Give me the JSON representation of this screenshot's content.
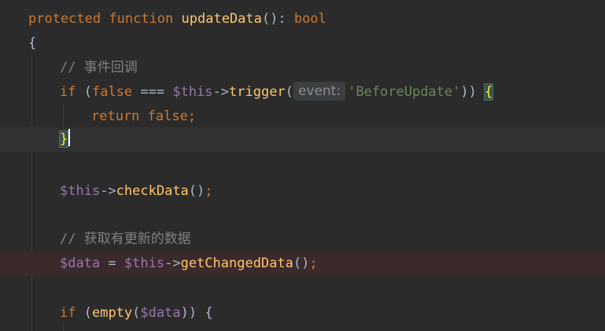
{
  "code": {
    "line1": {
      "kw_protected": "protected",
      "kw_function": "function",
      "fn_name": "updateData",
      "sig_rest": "(): ",
      "ret_type": "bool"
    },
    "line2": {
      "open_brace": "{"
    },
    "line3": {
      "comment": "// 事件回调"
    },
    "line4": {
      "kw_if": "if",
      "open": " (",
      "kw_false": "false",
      "op": " === ",
      "var_this": "$this",
      "arrow": "->",
      "method": "trigger",
      "paren_open": "(",
      "hint": "event:",
      "string": "'BeforeUpdate'",
      "close": ")) ",
      "brace": "{"
    },
    "line5": {
      "kw_return": "return",
      "space": " ",
      "kw_false": "false",
      "semi": ";"
    },
    "line6": {
      "brace": "}"
    },
    "line8": {
      "var_this": "$this",
      "arrow": "->",
      "method": "checkData",
      "parens": "()",
      "semi": ";"
    },
    "line10": {
      "comment": "// 获取有更新的数据"
    },
    "line11": {
      "var_data": "$data",
      "assign": " = ",
      "var_this": "$this",
      "arrow": "->",
      "method": "getChangedData",
      "parens": "()",
      "semi": ";"
    },
    "line13": {
      "kw_if": "if",
      "open": " (",
      "fn_empty": "empty",
      "paren_open": "(",
      "var_data": "$data",
      "close": ")) ",
      "brace": "{"
    }
  }
}
